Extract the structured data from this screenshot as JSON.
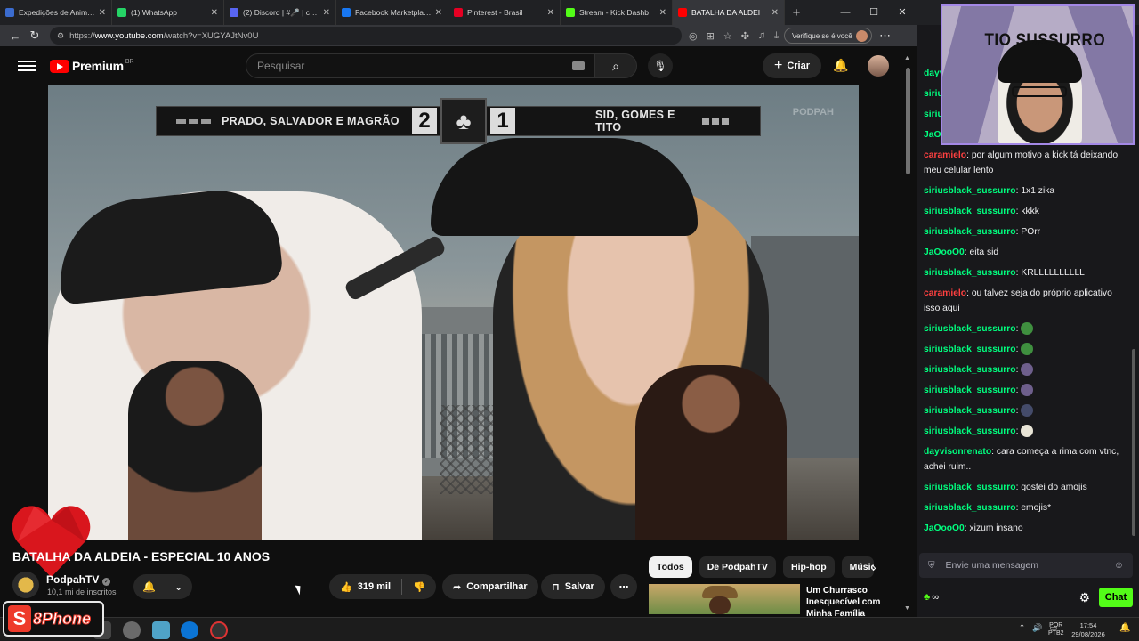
{
  "browser": {
    "tabs": [
      {
        "label": "Expedições de Anime | J",
        "color": "#3b6ccf",
        "active": false
      },
      {
        "label": "(1) WhatsApp",
        "color": "#25d366",
        "active": false
      },
      {
        "label": "(2) Discord | #🎤 | chat",
        "color": "#5865f2",
        "active": false
      },
      {
        "label": "Facebook Marketplace | ",
        "color": "#1877f2",
        "active": false
      },
      {
        "label": "Pinterest - Brasil",
        "color": "#e60023",
        "active": false
      },
      {
        "label": "Stream - Kick Dashb",
        "color": "#53fc18",
        "active": false
      },
      {
        "label": "BATALHA DA ALDEI",
        "color": "#ff0000",
        "active": true
      }
    ],
    "url_prefix": "https://",
    "url_host": "www.youtube.com",
    "url_path": "/watch?v=XUGYAJtNv0U",
    "verify_label": "Verifique se é você"
  },
  "youtube": {
    "brand": "Premium",
    "region": "BR",
    "search_placeholder": "Pesquisar",
    "create_label": "Criar"
  },
  "video": {
    "team_left": "PRADO, SALVADOR E MAGRÃO",
    "score_left": "2",
    "score_right": "1",
    "team_right": "SID, GOMES E TITO",
    "watermark": "PODPAH",
    "title": "BATALHA DA ALDEIA - ESPECIAL 10 ANOS",
    "channel_name": "PodpahTV",
    "channel_subs": "10,1 mi de inscritos",
    "likes": "319 mil",
    "share_label": "Compartilhar",
    "save_label": "Salvar"
  },
  "chips": [
    "Todos",
    "De PodpahTV",
    "Hip-hop",
    "Músic"
  ],
  "recommendation": {
    "title": "Um Churrasco Inesquecível com Minha Família"
  },
  "chat": {
    "webcam_label": "TIO SUSSURRO",
    "messages": [
      {
        "user": "dayvisonrenato",
        "color": "#00ff7f",
        "text": ""
      },
      {
        "user": "siriusblack_sussurro",
        "color": "#00ff7f",
        "text": ""
      },
      {
        "user": "siriusblack_sussurro",
        "color": "#00ff7f",
        "text": ""
      },
      {
        "user": "JaOooO0",
        "color": "#00ff7f",
        "text": ""
      },
      {
        "user": "caramielo",
        "color": "#ff4040",
        "text": "por algum motivo a kick tá deixando meu celular lento"
      },
      {
        "user": "siriusblack_sussurro",
        "color": "#00ff7f",
        "text": "1x1 zika"
      },
      {
        "user": "siriusblack_sussurro",
        "color": "#00ff7f",
        "text": "kkkk"
      },
      {
        "user": "siriusblack_sussurro",
        "color": "#00ff7f",
        "text": "POrr"
      },
      {
        "user": "JaOooO0",
        "color": "#00ff7f",
        "text": "eita sid"
      },
      {
        "user": "siriusblack_sussurro",
        "color": "#00ff7f",
        "text": "KRLLLLLLLLLL"
      },
      {
        "user": "caramielo",
        "color": "#ff4040",
        "text": "ou talvez seja do próprio aplicativo isso aqui"
      },
      {
        "user": "siriusblack_sussurro",
        "color": "#00ff7f",
        "text": "",
        "emoji": "#3f8f3f"
      },
      {
        "user": "siriusblack_sussurro",
        "color": "#00ff7f",
        "text": "",
        "emoji": "#3f8f3f"
      },
      {
        "user": "siriusblack_sussurro",
        "color": "#00ff7f",
        "text": "",
        "emoji": "#6e5f8c"
      },
      {
        "user": "siriusblack_sussurro",
        "color": "#00ff7f",
        "text": "",
        "emoji": "#6e5f8c"
      },
      {
        "user": "siriusblack_sussurro",
        "color": "#00ff7f",
        "text": "",
        "emoji": "#444b6a"
      },
      {
        "user": "siriusblack_sussurro",
        "color": "#00ff7f",
        "text": "",
        "emoji": "#e8e4d6"
      },
      {
        "user": "dayvisonrenato",
        "color": "#00ff7f",
        "text": "cara começa a rima com vtnc, achei ruim.."
      },
      {
        "user": "siriusblack_sussurro",
        "color": "#00ff7f",
        "text": "gostei do amojis"
      },
      {
        "user": "siriusblack_sussurro",
        "color": "#00ff7f",
        "text": "emojis*"
      },
      {
        "user": "JaOooO0",
        "color": "#00ff7f",
        "text": "xizum insano"
      }
    ],
    "input_placeholder": "Envie uma mensagem",
    "chat_button": "Chat",
    "accent": "#53fc18"
  },
  "taskbar": {
    "lang_top": "POR",
    "lang_bottom": "PTB2",
    "time": "17:54",
    "date": "29/08/2026"
  },
  "overlay": {
    "logo_letter": "S",
    "logo_text": "8Phone"
  }
}
